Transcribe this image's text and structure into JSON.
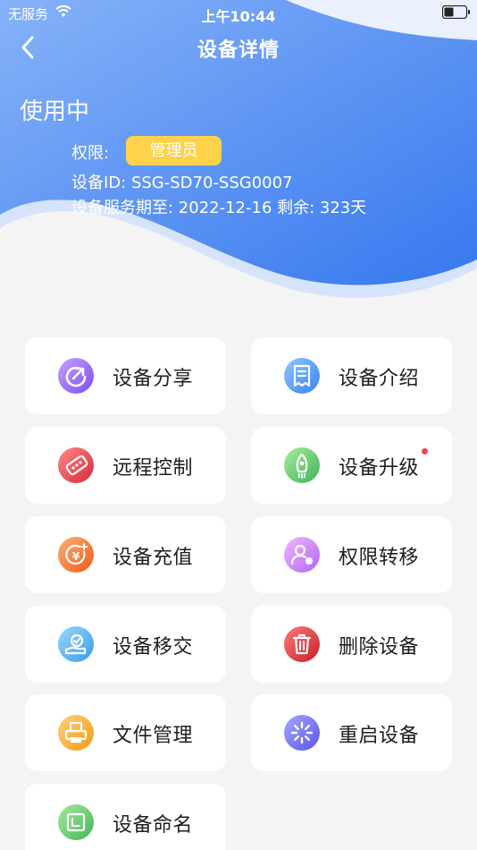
{
  "status_bar": {
    "carrier": "无服务",
    "time": "上午10:44"
  },
  "nav": {
    "title": "设备详情"
  },
  "device": {
    "status": "使用中",
    "permission_label": "权限:",
    "permission_value": "管理员",
    "id_text": "设备ID:  SSG-SD70-SSG0007",
    "service_text": "设备服务期至:  2022-12-16 剩余:  323天"
  },
  "menu": [
    {
      "label": "设备分享",
      "icon": "share-icon"
    },
    {
      "label": "设备介绍",
      "icon": "document-icon"
    },
    {
      "label": "远程控制",
      "icon": "remote-control-icon"
    },
    {
      "label": "设备升级",
      "icon": "rocket-icon",
      "badge": true
    },
    {
      "label": "设备充值",
      "icon": "recharge-icon"
    },
    {
      "label": "权限转移",
      "icon": "user-transfer-icon"
    },
    {
      "label": "设备移交",
      "icon": "handover-icon"
    },
    {
      "label": "删除设备",
      "icon": "trash-icon"
    },
    {
      "label": "文件管理",
      "icon": "printer-icon"
    },
    {
      "label": "重启设备",
      "icon": "restart-icon"
    },
    {
      "label": "设备命名",
      "icon": "rename-icon"
    }
  ],
  "colors": {
    "hero_top": "#8fb8f8",
    "hero_bottom": "#3f7fef",
    "badge": "#ffd24a",
    "dot": "#f04848"
  }
}
